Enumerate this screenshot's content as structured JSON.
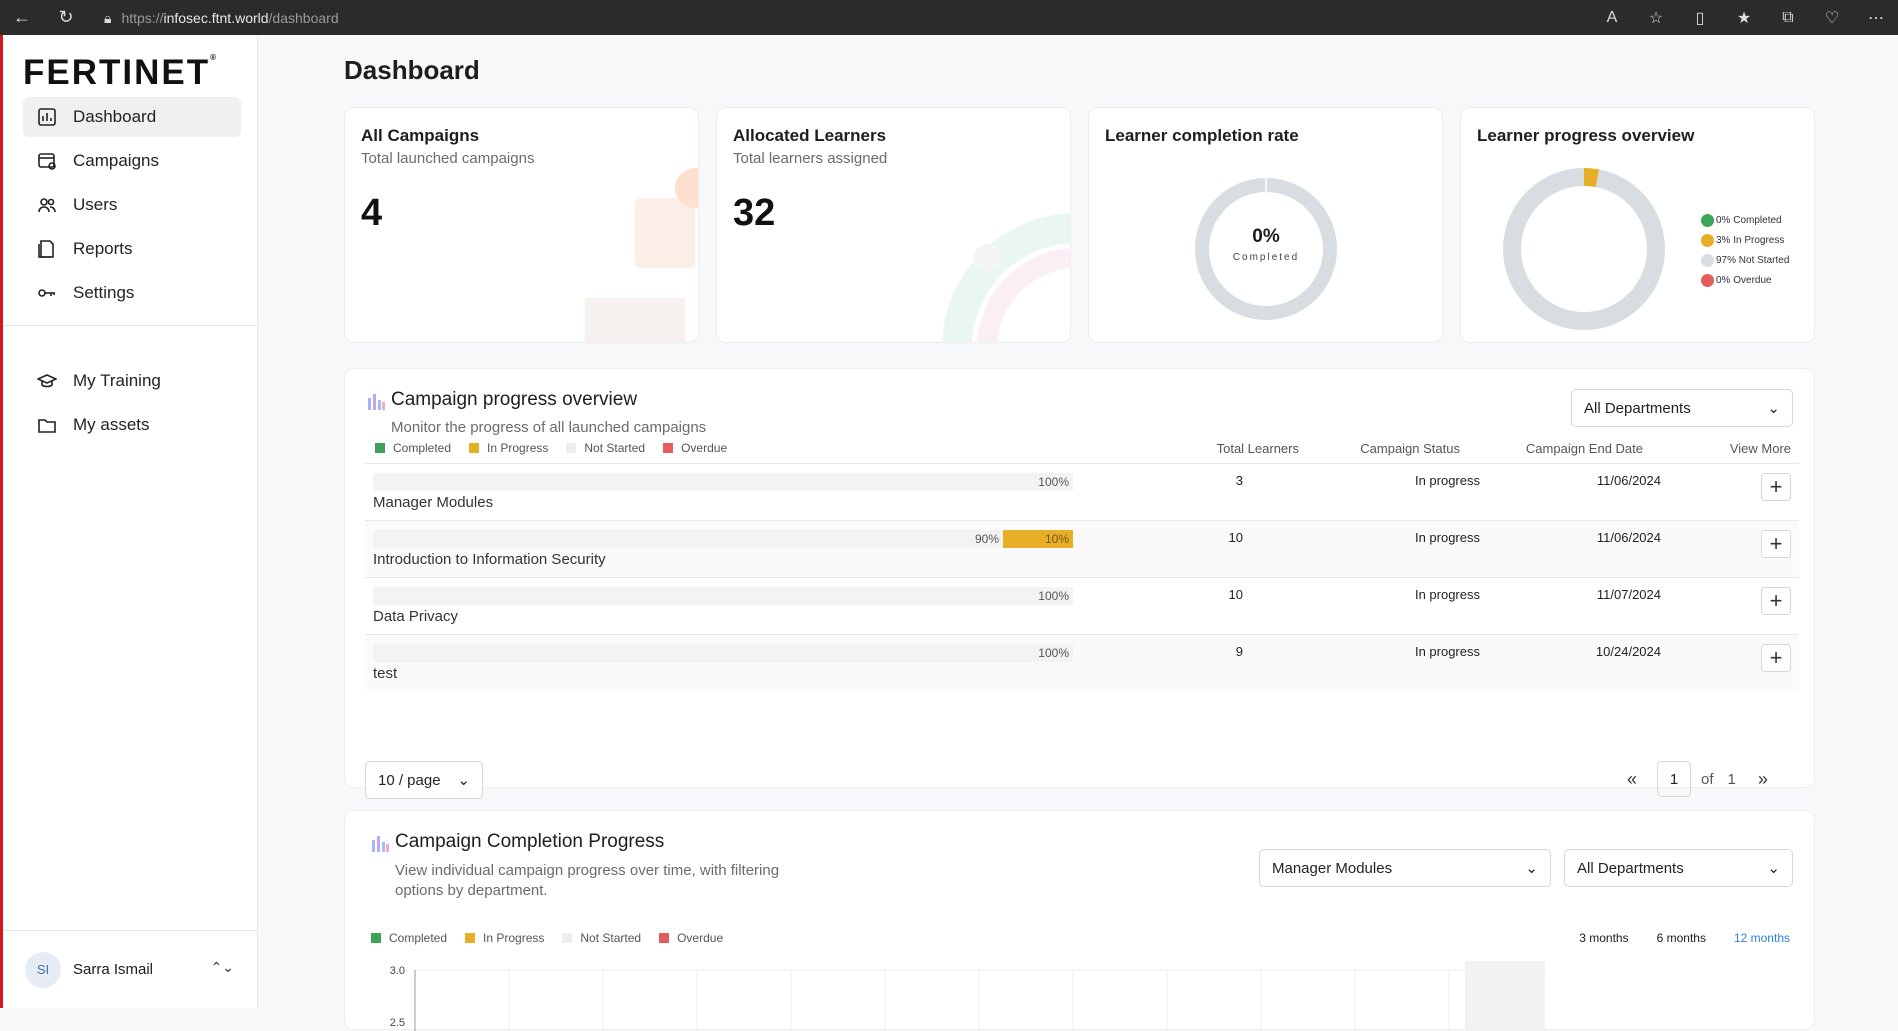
{
  "browser": {
    "url_prefix": "https://",
    "url_host": "infosec.ftnt.world",
    "url_path": "/dashboard"
  },
  "logo": {
    "text": "FERTINET",
    "mark": "®"
  },
  "sidebar": {
    "items": [
      {
        "label": "Dashboard"
      },
      {
        "label": "Campaigns"
      },
      {
        "label": "Users"
      },
      {
        "label": "Reports"
      },
      {
        "label": "Settings"
      }
    ],
    "items2": [
      {
        "label": "My Training"
      },
      {
        "label": "My assets"
      }
    ],
    "user": {
      "initials": "SI",
      "name": "Sarra Ismail"
    }
  },
  "page": {
    "title": "Dashboard"
  },
  "cards": {
    "campaigns": {
      "title": "All Campaigns",
      "sub": "Total launched campaigns",
      "value": "4"
    },
    "learners": {
      "title": "Allocated Learners",
      "sub": "Total learners assigned",
      "value": "32"
    },
    "completion": {
      "title": "Learner completion rate",
      "value": "0%",
      "label": "Completed",
      "completed_fraction": 0
    },
    "overview": {
      "title": "Learner progress overview",
      "legend": [
        "0% Completed",
        "3% In Progress",
        "97% Not Started",
        "0% Overdue"
      ],
      "slices": [
        0,
        3,
        97,
        0
      ]
    }
  },
  "colors": {
    "completed": "#3fa45b",
    "in_progress": "#e7ae28",
    "not_started": "#eeeeee",
    "overdue": "#e35d5d",
    "ring": "#d8dde1",
    "link": "#2f7fe0"
  },
  "progress_panel": {
    "title": "Campaign progress overview",
    "subtitle": "Monitor the progress of all launched campaigns",
    "department_select": "All Departments",
    "legend": [
      "Completed",
      "In Progress",
      "Not Started",
      "Overdue"
    ],
    "columns": {
      "learners": "Total Learners",
      "status": "Campaign Status",
      "end": "Campaign End Date",
      "more": "View More"
    },
    "rows": [
      {
        "name": "Manager Modules",
        "not_started": "100%",
        "in_progress": "",
        "ip_pct": 0,
        "learners": "3",
        "status": "In progress",
        "end": "11/06/2024"
      },
      {
        "name": "Introduction to Information Security",
        "not_started": "90%",
        "in_progress": "10%",
        "ip_pct": 10,
        "learners": "10",
        "status": "In progress",
        "end": "11/06/2024"
      },
      {
        "name": "Data Privacy",
        "not_started": "100%",
        "in_progress": "",
        "ip_pct": 0,
        "learners": "10",
        "status": "In progress",
        "end": "11/07/2024"
      },
      {
        "name": "test",
        "not_started": "100%",
        "in_progress": "",
        "ip_pct": 0,
        "learners": "9",
        "status": "In progress",
        "end": "10/24/2024"
      }
    ],
    "page_size": "10 / page",
    "page": "1",
    "of": "of",
    "total_pages": "1"
  },
  "completion_panel": {
    "title": "Campaign Completion Progress",
    "subtitle_1": "View individual campaign progress over time, with filtering",
    "subtitle_2": "options by department.",
    "campaign_select": "Manager Modules",
    "department_select": "All Departments",
    "legend": [
      "Completed",
      "In Progress",
      "Not Started",
      "Overdue"
    ],
    "ranges": [
      "3 months",
      "6 months",
      "12 months"
    ],
    "active_range": "12 months",
    "y_ticks": [
      "3.0",
      "2.5"
    ]
  }
}
